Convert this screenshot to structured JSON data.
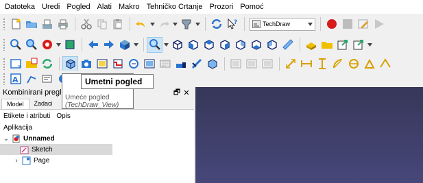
{
  "menubar": {
    "items": [
      "Datoteka",
      "Uredi",
      "Pogled",
      "Alati",
      "Makro",
      "Tehničko Crtanje",
      "Prozori",
      "Pomoć"
    ]
  },
  "toolbar": {
    "workbench_selector": "TechDraw",
    "row1_icons": [
      "new-document-icon",
      "open-folder-icon",
      "save-icon",
      "print-icon",
      "cut-icon",
      "copy-icon",
      "paste-icon",
      "undo-icon",
      "redo-icon",
      "refresh-icon",
      "whats-this-icon",
      "workbench-icon",
      "record-macro-icon",
      "stop-macro-icon",
      "edit-macro-icon",
      "run-macro-icon"
    ],
    "row2_icons": [
      "fit-all-icon",
      "fit-selection-icon",
      "draw-style-icon",
      "bounding-box-icon",
      "back-icon",
      "forward-icon",
      "navigation-icon",
      "zoom-icon",
      "isometric-view-icon",
      "front-view-icon",
      "top-view-icon",
      "right-view-icon",
      "rear-view-icon",
      "bottom-view-icon",
      "left-view-icon",
      "measure-icon",
      "part-icon",
      "folder-icon",
      "link-icon",
      "link-actions-icon"
    ],
    "row3_icons": [
      "new-page-default-icon",
      "new-page-template-icon",
      "redraw-page-icon",
      "insert-view-icon",
      "active-view-icon",
      "section-view-icon",
      "complex-section-icon",
      "detail-view-icon",
      "projection-group-icon",
      "clip-group-icon",
      "arch-view-icon",
      "draft-view-icon",
      "spreadsheet-view-icon",
      "image-icon",
      "symbol-icon",
      "length-dimension-icon",
      "horizontal-dimension-icon",
      "vertical-dimension-icon",
      "radius-dimension-icon",
      "diameter-dimension-icon",
      "angle-dimension-icon",
      "three-point-angle-icon"
    ],
    "row4_icons": [
      "annotation-icon",
      "leader-line-icon",
      "rich-annotation-icon",
      "balloon-icon",
      "line-edit-icon",
      "toggle-frames-icon",
      "export-page-icon"
    ]
  },
  "tooltip": {
    "title": "Umetni pogled",
    "description": "Umeće pogled",
    "command": "(TechDraw_View)"
  },
  "combo_view": {
    "title": "Kombinirani pregled",
    "float_control": "🗗",
    "close_control": "✕",
    "tabs": [
      "Model",
      "Zadaci"
    ],
    "columns": [
      "Etikete i atributi",
      "Opis"
    ],
    "tree": {
      "root_label": "Aplikacija",
      "document": "Unnamed",
      "children": [
        "Sketch",
        "Page"
      ]
    }
  },
  "colors": {
    "accent": "#0078d7",
    "view_bg_top": "#37375a",
    "view_bg_bottom": "#47477a",
    "selection": "#d9d9d9"
  }
}
